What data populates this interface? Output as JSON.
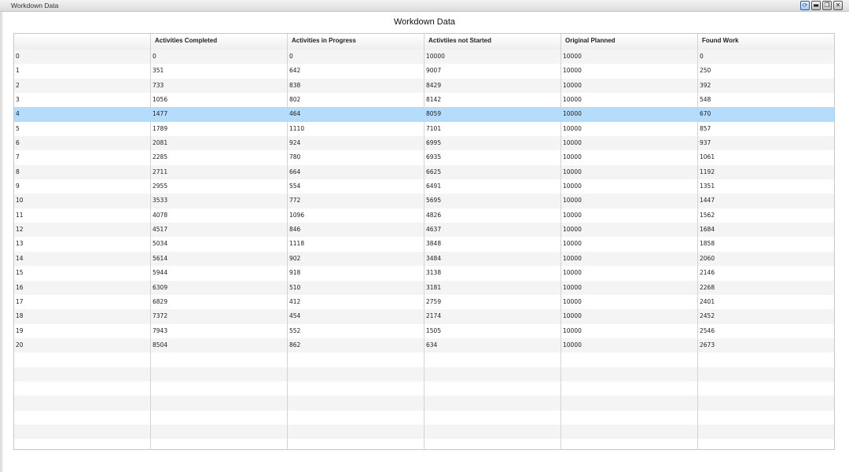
{
  "window": {
    "title": "Workdown Data",
    "controls": [
      "refresh-icon",
      "minimize-icon",
      "restore-icon",
      "close-icon"
    ]
  },
  "table": {
    "title": "Workdown Data",
    "columns": [
      "",
      "Activities Completed",
      "Activities in Progress",
      "Activtiies not Started",
      "Original Planned",
      "Found Work"
    ],
    "selected_row": 4,
    "selection_color": "#b5dcfb",
    "rows": [
      [
        "0",
        "0",
        "0",
        "10000",
        "10000",
        "0"
      ],
      [
        "1",
        "351",
        "642",
        "9007",
        "10000",
        "250"
      ],
      [
        "2",
        "733",
        "838",
        "8429",
        "10000",
        "392"
      ],
      [
        "3",
        "1056",
        "802",
        "8142",
        "10000",
        "548"
      ],
      [
        "4",
        "1477",
        "464",
        "8059",
        "10000",
        "670"
      ],
      [
        "5",
        "1789",
        "1110",
        "7101",
        "10000",
        "857"
      ],
      [
        "6",
        "2081",
        "924",
        "6995",
        "10000",
        "937"
      ],
      [
        "7",
        "2285",
        "780",
        "6935",
        "10000",
        "1061"
      ],
      [
        "8",
        "2711",
        "664",
        "6625",
        "10000",
        "1192"
      ],
      [
        "9",
        "2955",
        "554",
        "6491",
        "10000",
        "1351"
      ],
      [
        "10",
        "3533",
        "772",
        "5695",
        "10000",
        "1447"
      ],
      [
        "11",
        "4078",
        "1096",
        "4826",
        "10000",
        "1562"
      ],
      [
        "12",
        "4517",
        "846",
        "4637",
        "10000",
        "1684"
      ],
      [
        "13",
        "5034",
        "1118",
        "3848",
        "10000",
        "1858"
      ],
      [
        "14",
        "5614",
        "902",
        "3484",
        "10000",
        "2060"
      ],
      [
        "15",
        "5944",
        "918",
        "3138",
        "10000",
        "2146"
      ],
      [
        "16",
        "6309",
        "510",
        "3181",
        "10000",
        "2268"
      ],
      [
        "17",
        "6829",
        "412",
        "2759",
        "10000",
        "2401"
      ],
      [
        "18",
        "7372",
        "454",
        "2174",
        "10000",
        "2452"
      ],
      [
        "19",
        "7943",
        "552",
        "1505",
        "10000",
        "2546"
      ],
      [
        "20",
        "8504",
        "862",
        "634",
        "10000",
        "2673"
      ]
    ]
  }
}
